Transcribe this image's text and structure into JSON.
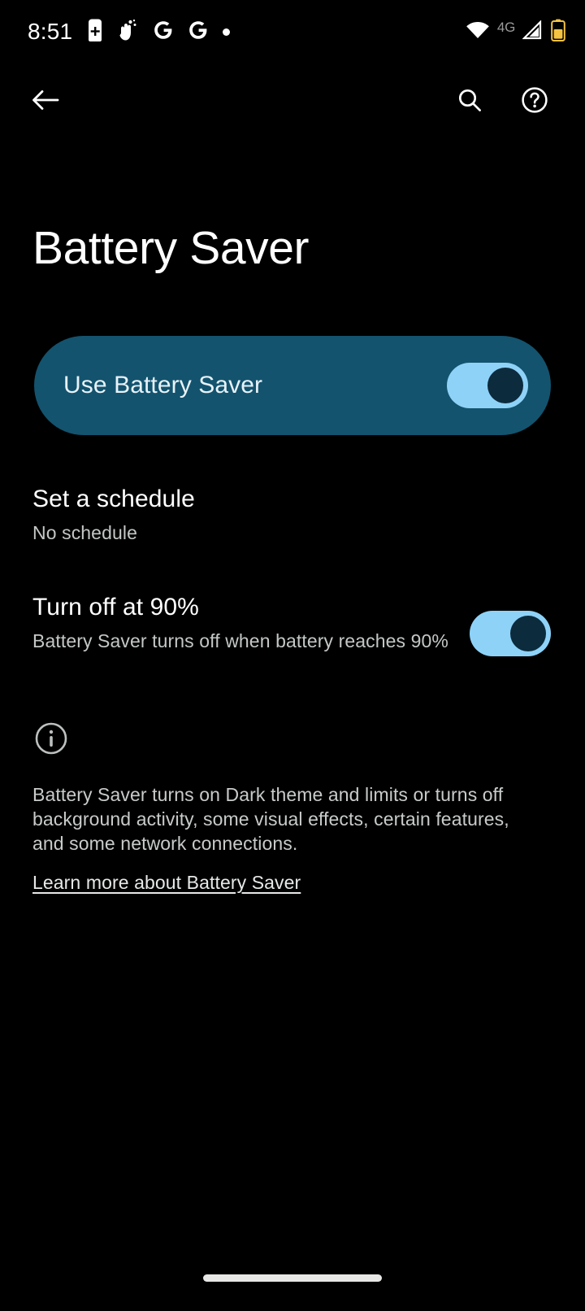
{
  "status_bar": {
    "time": "8:51",
    "left_icons": [
      "battery-saver-icon",
      "gesture-hand-icon",
      "google-g-icon",
      "google-g-icon",
      "notification-dot-icon"
    ],
    "network_label": "4G",
    "right_icons": [
      "wifi-icon",
      "cellular-signal-icon",
      "battery-icon"
    ],
    "battery_color": "#f5c342"
  },
  "toolbar": {
    "back_icon": "back-arrow-icon",
    "search_icon": "search-icon",
    "help_icon": "help-circle-icon"
  },
  "page": {
    "title": "Battery Saver"
  },
  "main_toggle": {
    "label": "Use Battery Saver",
    "state": "on",
    "card_color": "#13536e",
    "track_color": "#8ed2f8",
    "thumb_color": "#0c2b3d"
  },
  "rows": [
    {
      "title": "Set a schedule",
      "subtitle": "No schedule",
      "has_switch": false
    },
    {
      "title": "Turn off at 90%",
      "subtitle": "Battery Saver turns off when battery reaches 90%",
      "has_switch": true,
      "state": "on"
    }
  ],
  "footer": {
    "info_icon": "info-circle-icon",
    "description": "Battery Saver turns on Dark theme and limits or turns off background activity, some visual effects, certain features, and some network connections.",
    "link_label": "Learn more about Battery Saver"
  },
  "navigation": {
    "home_bar": "home-gesture-bar"
  }
}
